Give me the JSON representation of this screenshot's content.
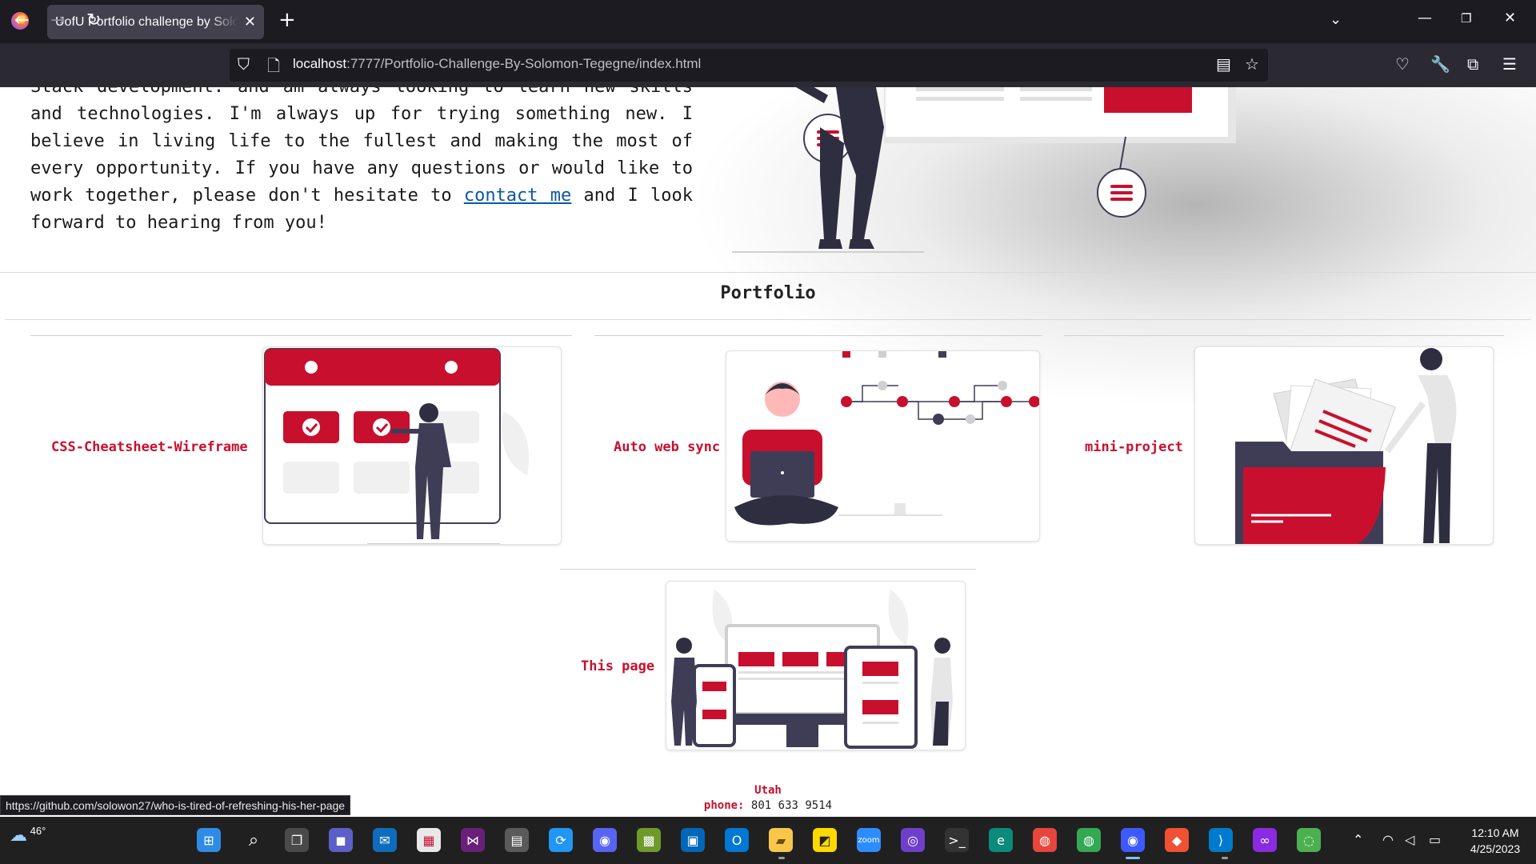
{
  "browser": {
    "tab_title": "UofU Portfolio challenge by Solomon Tegegne",
    "url_host": "localhost",
    "url_rest": ":7777/Portfolio-Challenge-By-Solomon-Tegegne/index.html",
    "status_url": "https://github.com/solowon27/who-is-tired-of-refreshing-his-her-page"
  },
  "about": {
    "line0": "Stack development. and am always looking to learn new skills and",
    "text_before_link": "technologies. I'm always up for trying something new. I believe in living life to the fullest and making the most of every opportunity. If you have any questions or would like to work together, please don't hesitate to ",
    "link_text": "contact me",
    "text_after_link": " and I look forward to hearing from you!"
  },
  "portfolio": {
    "title": "Portfolio",
    "projects": [
      {
        "label": "CSS-Cheatsheet-Wireframe"
      },
      {
        "label": "Auto web sync"
      },
      {
        "label": "mini-project"
      },
      {
        "label": "This page"
      }
    ]
  },
  "footer": {
    "state": "Utah",
    "phone_label": "phone:",
    "phone_number": "801 633 9514"
  },
  "taskbar": {
    "weather_temp": "46°",
    "time": "12:10 AM",
    "date": "4/25/2023"
  },
  "colors": {
    "accent": "#c8102e",
    "link": "#0b57a4",
    "chrome_dark": "#1c1b22",
    "chrome_mid": "#2b2a33",
    "taskbar": "#202020"
  }
}
